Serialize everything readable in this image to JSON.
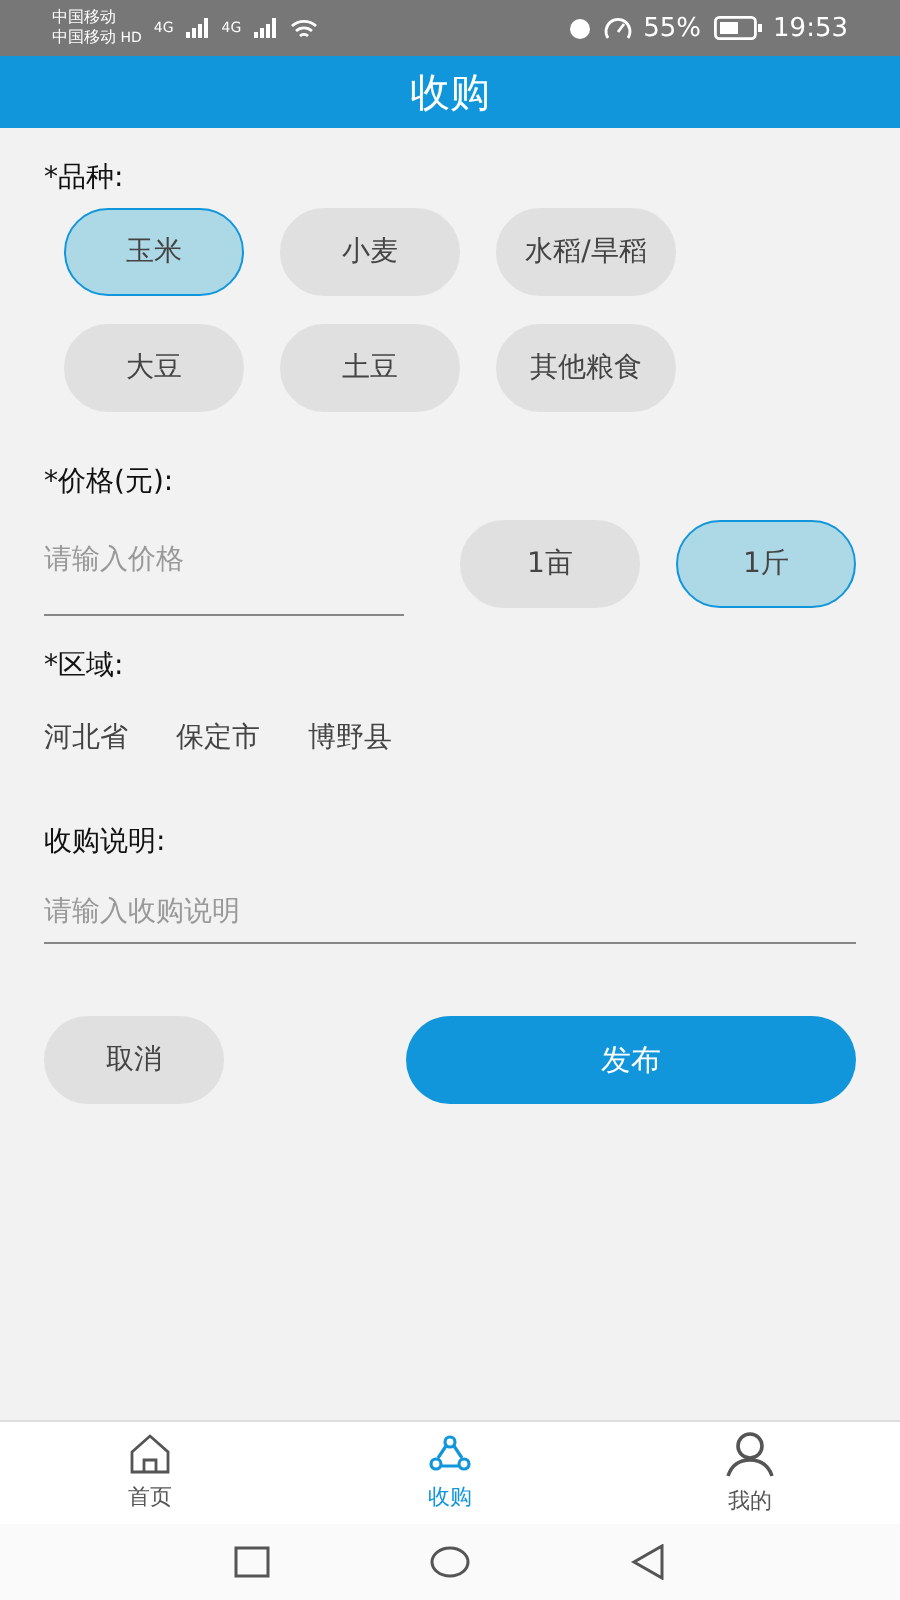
{
  "status_bar": {
    "carriers": [
      "中国移动",
      "中国移动"
    ],
    "hd": "HD",
    "network": [
      "4G",
      "4G"
    ],
    "battery": "55%",
    "time": "19:53"
  },
  "header": {
    "title": "收购"
  },
  "variety": {
    "label": "*品种:",
    "options": [
      {
        "label": "玉米",
        "selected": true
      },
      {
        "label": "小麦",
        "selected": false
      },
      {
        "label": "水稻/旱稻",
        "selected": false
      },
      {
        "label": "大豆",
        "selected": false
      },
      {
        "label": "土豆",
        "selected": false
      },
      {
        "label": "其他粮食",
        "selected": false
      }
    ]
  },
  "price": {
    "label": "*价格(元):",
    "placeholder": "请输入价格",
    "units": [
      {
        "label": "1亩",
        "selected": false
      },
      {
        "label": "1斤",
        "selected": true
      }
    ]
  },
  "region": {
    "label": "*区域:",
    "values": [
      "河北省",
      "保定市",
      "博野县"
    ]
  },
  "description": {
    "label": "收购说明:",
    "placeholder": "请输入收购说明"
  },
  "actions": {
    "cancel": "取消",
    "submit": "发布"
  },
  "tab_bar": [
    {
      "label": "首页",
      "kind": "home",
      "selected": false
    },
    {
      "label": "收购",
      "kind": "network",
      "selected": true
    },
    {
      "label": "我的",
      "kind": "user",
      "selected": false
    }
  ]
}
